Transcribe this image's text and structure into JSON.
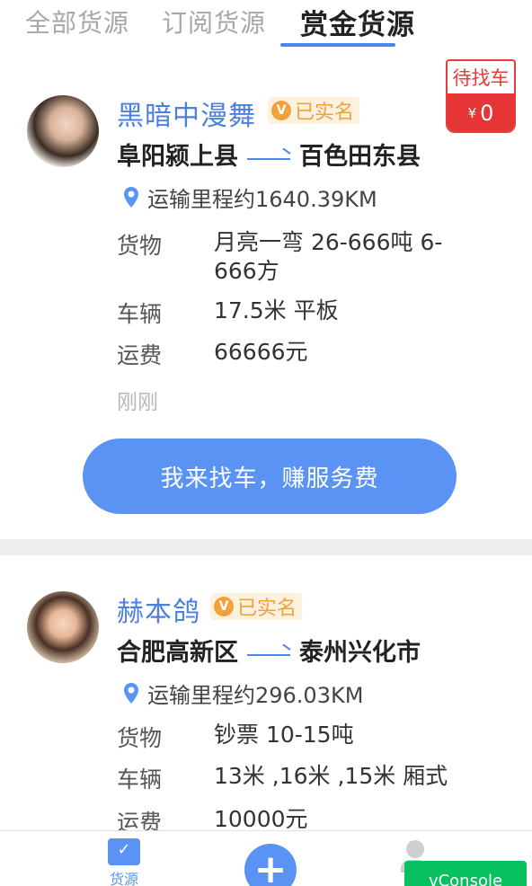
{
  "tabs": [
    {
      "label": "全部货源"
    },
    {
      "label": "订阅货源"
    },
    {
      "label": "赏金货源"
    }
  ],
  "active_tab": 2,
  "listings": [
    {
      "name": "黑暗中漫舞",
      "verify_mark": "V",
      "verified_label": "已实名",
      "from": "阜阳颍上县",
      "to": "百色田东县",
      "distance": "运输里程约1640.39KM",
      "cargo_label": "货物",
      "cargo_value": "月亮一弯 26-666吨 6-666方",
      "vehicle_label": "车辆",
      "vehicle_value": "17.5米 平板",
      "fee_label": "运费",
      "fee_value": "66666元",
      "time": "刚刚",
      "cta_label": "我来找车，赚服务费",
      "badge_status": "待找车",
      "badge_currency": "¥",
      "badge_amount": "0"
    },
    {
      "name": "赫本鸽",
      "verify_mark": "V",
      "verified_label": "已实名",
      "from": "合肥高新区",
      "to": "泰州兴化市",
      "distance": "运输里程约296.03KM",
      "cargo_label": "货物",
      "cargo_value": "钞票 10-15吨",
      "vehicle_label": "车辆",
      "vehicle_value": "13米 ,16米 ,15米 厢式",
      "fee_label": "运费",
      "fee_value": "10000元"
    }
  ],
  "bottom_nav": {
    "home_label": "货源",
    "add_symbol": "+"
  },
  "vconsole_label": "vConsole",
  "colors": {
    "accent": "#5b93f5",
    "name": "#4b7fe0",
    "verified": "#f0a13a",
    "badge_red": "#e53535",
    "vconsole": "#07c160"
  },
  "icons": {
    "verify": "verified-check-icon",
    "distance": "location-pin-icon",
    "route": "arrow-right-icon",
    "home": "cargo-list-icon",
    "add": "plus-icon",
    "profile": "user-icon"
  }
}
